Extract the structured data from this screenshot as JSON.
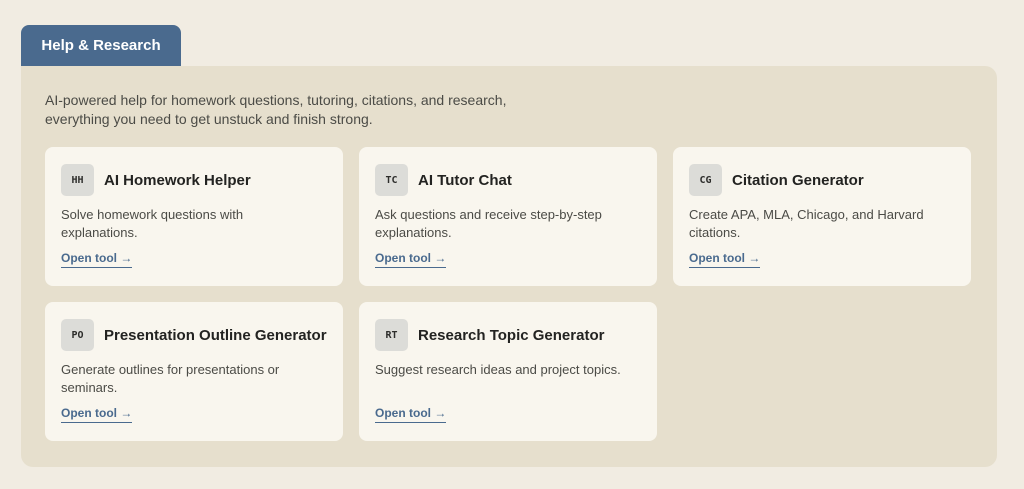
{
  "tab": {
    "label": "Help & Research"
  },
  "intro": {
    "line1": "AI-powered help for homework questions, tutoring, citations, and research,",
    "line2": "everything you need to get unstuck and finish strong."
  },
  "cards": [
    {
      "badge": "HH",
      "title": "AI Homework Helper",
      "description": "Solve homework questions with explanations.",
      "link": "Open tool →"
    },
    {
      "badge": "TC",
      "title": "AI Tutor Chat",
      "description": "Ask questions and receive step-by-step explanations.",
      "link": "Open tool →"
    },
    {
      "badge": "CG",
      "title": "Citation Generator",
      "description": "Create APA, MLA, Chicago, and Harvard citations.",
      "link": "Open tool →"
    },
    {
      "badge": "PO",
      "title": "Presentation Outline Generator",
      "description": "Generate outlines for presentations or seminars.",
      "link": "Open tool →"
    },
    {
      "badge": "RT",
      "title": "Research Topic Generator",
      "description": "Suggest research ideas and project topics.",
      "link": "Open tool →"
    }
  ],
  "colors": {
    "page_background": "#f1ece2",
    "panel_background": "#e6dfcd",
    "card_background": "#f9f6ee",
    "accent": "#4a6a8e",
    "badge_background": "#dcdcd8"
  }
}
